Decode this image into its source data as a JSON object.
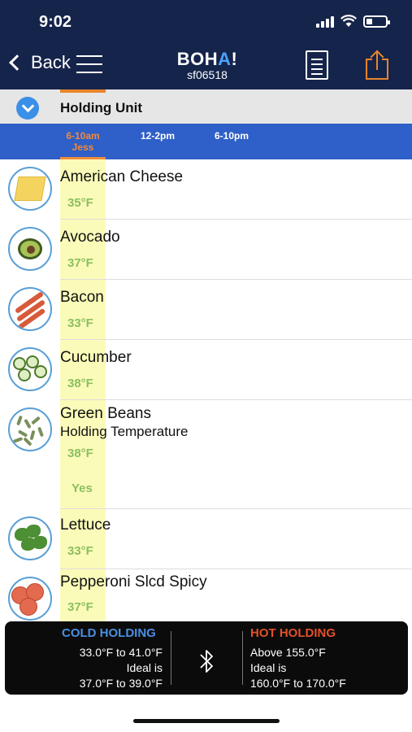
{
  "status": {
    "time": "9:02"
  },
  "nav": {
    "back_label": "Back",
    "brand": "BOH",
    "brand_accent": "A",
    "brand_suffix": "!",
    "store_id": "sf06518"
  },
  "unit": {
    "title": "Holding Unit"
  },
  "tabs": [
    {
      "label": "6-10am",
      "sub": "Jess",
      "active": true
    },
    {
      "label": "12-2pm",
      "sub": ""
    },
    {
      "label": "6-10pm",
      "sub": ""
    }
  ],
  "items": [
    {
      "name": "American Cheese",
      "temp": "35°F"
    },
    {
      "name": "Avocado",
      "temp": "37°F"
    },
    {
      "name": "Bacon",
      "temp": "33°F"
    },
    {
      "name": "Cucumber",
      "temp": "38°F"
    },
    {
      "name": "Green Beans",
      "subtitle": "Holding Temperature",
      "temp": "38°F",
      "extra": "Yes"
    },
    {
      "name": "Lettuce",
      "temp": "33°F"
    },
    {
      "name": "Pepperoni Slcd Spicy",
      "temp": "37°F"
    }
  ],
  "cold": {
    "title": "COLD HOLDING",
    "line1": "33.0°F to 41.0°F",
    "line2": "Ideal is",
    "line3": "37.0°F to 39.0°F"
  },
  "hot": {
    "title": "HOT HOLDING",
    "line1": "Above 155.0°F",
    "line2": "Ideal is",
    "line3": "160.0°F to 170.0°F"
  },
  "colors": {
    "navy": "#15244a",
    "tab_blue": "#2f5fc8",
    "orange": "#e8852c",
    "temp_green": "#8bbf60",
    "highlight": "#fbfbb9"
  }
}
